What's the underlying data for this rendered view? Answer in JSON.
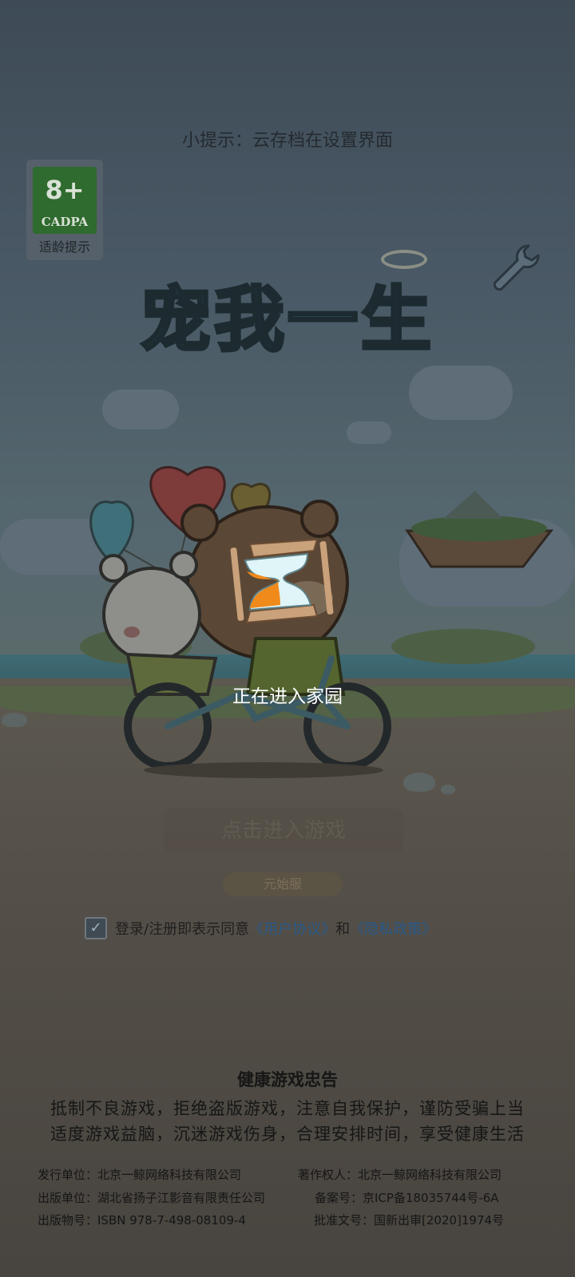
{
  "tip": "小提示：云存档在设置界面",
  "age_rating": {
    "number": "8+",
    "brand": "CADPA",
    "label": "适龄提示"
  },
  "logo_text": "宠我一生",
  "loading_text": "正在进入家园",
  "enter_button": "点击进入游戏",
  "server_button": "元始服",
  "agreement": {
    "checked": true,
    "prefix": "登录/注册即表示同意",
    "user_agreement": "《用户协议》",
    "conj": "和",
    "privacy_policy": "《隐私政策》"
  },
  "health_notice": {
    "title": "健康游戏忠告",
    "line1": "抵制不良游戏，拒绝盗版游戏，注意自我保护，谨防受骗上当",
    "line2": "适度游戏益脑，沉迷游戏伤身，合理安排时间，享受健康生活"
  },
  "publication_info": {
    "publisher": "发行单位：北京一鲸网络科技有限公司",
    "copyright": "著作权人：北京一鲸网络科技有限公司",
    "publishing_unit": "出版单位：湖北省扬子江影音有限责任公司",
    "record_no": "备案号：京ICP备18035744号-6A",
    "isbn": "出版物号：ISBN 978-7-498-08109-4",
    "approval_no": "批准文号：国新出审[2020]1974号"
  },
  "colors": {
    "link": "#2a5a8a",
    "background": "#3d4a56"
  }
}
